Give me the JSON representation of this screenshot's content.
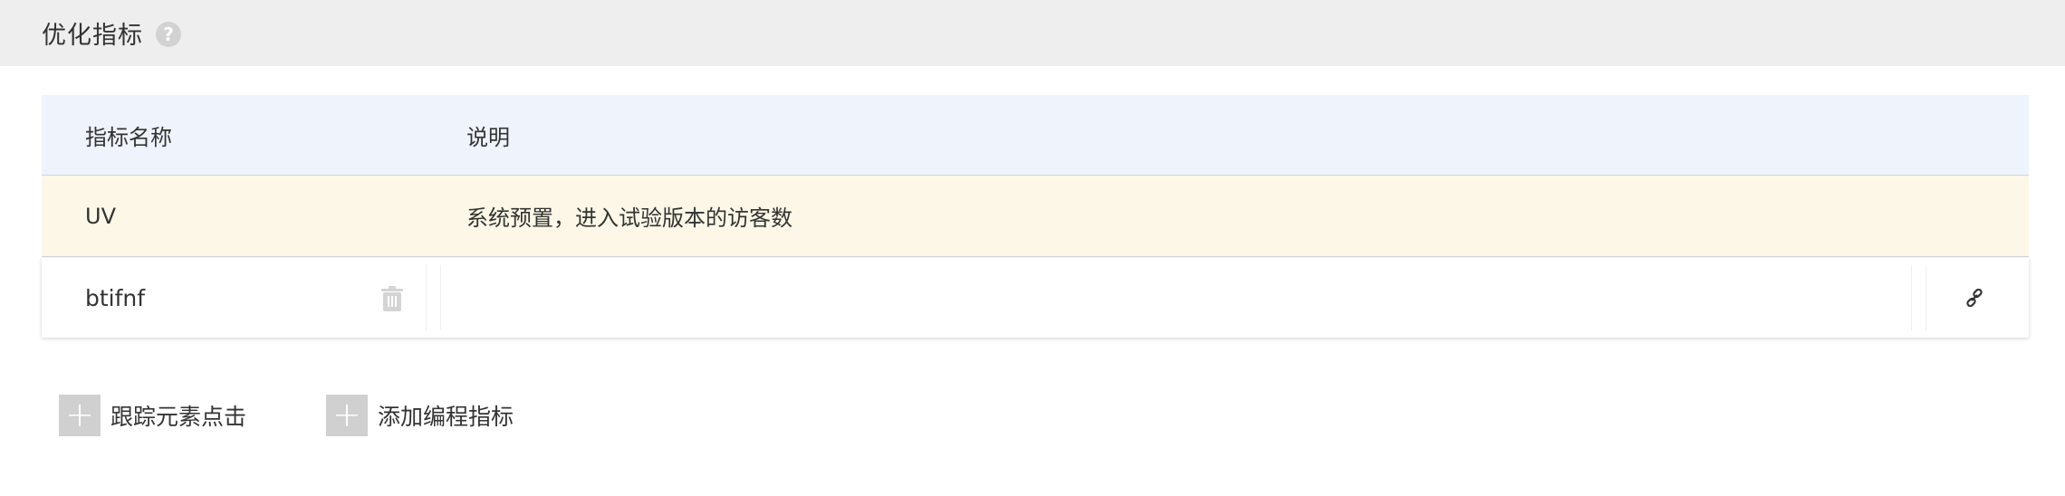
{
  "section": {
    "title": "优化指标",
    "help_icon": "?"
  },
  "table": {
    "columns": {
      "name": "指标名称",
      "description": "说明"
    },
    "rows": [
      {
        "name": "UV",
        "description": "系统预置，进入试验版本的访客数",
        "highlight_color": "#fcf7e6"
      },
      {
        "name": "btifnf",
        "description": ""
      }
    ]
  },
  "icons": {
    "help": "question-circle-icon",
    "delete": "trash-icon",
    "link": "link-icon",
    "add": "plus-icon"
  },
  "actions": {
    "track_click_label": "跟踪元素点击",
    "add_programmatic_label": "添加编程指标",
    "plus_glyph": "+"
  },
  "colors": {
    "header_bg": "#eeeeee",
    "table_head_bg": "#eef3fc",
    "preset_row_bg": "#fcf7e6",
    "button_bg": "#d0d0d0"
  }
}
